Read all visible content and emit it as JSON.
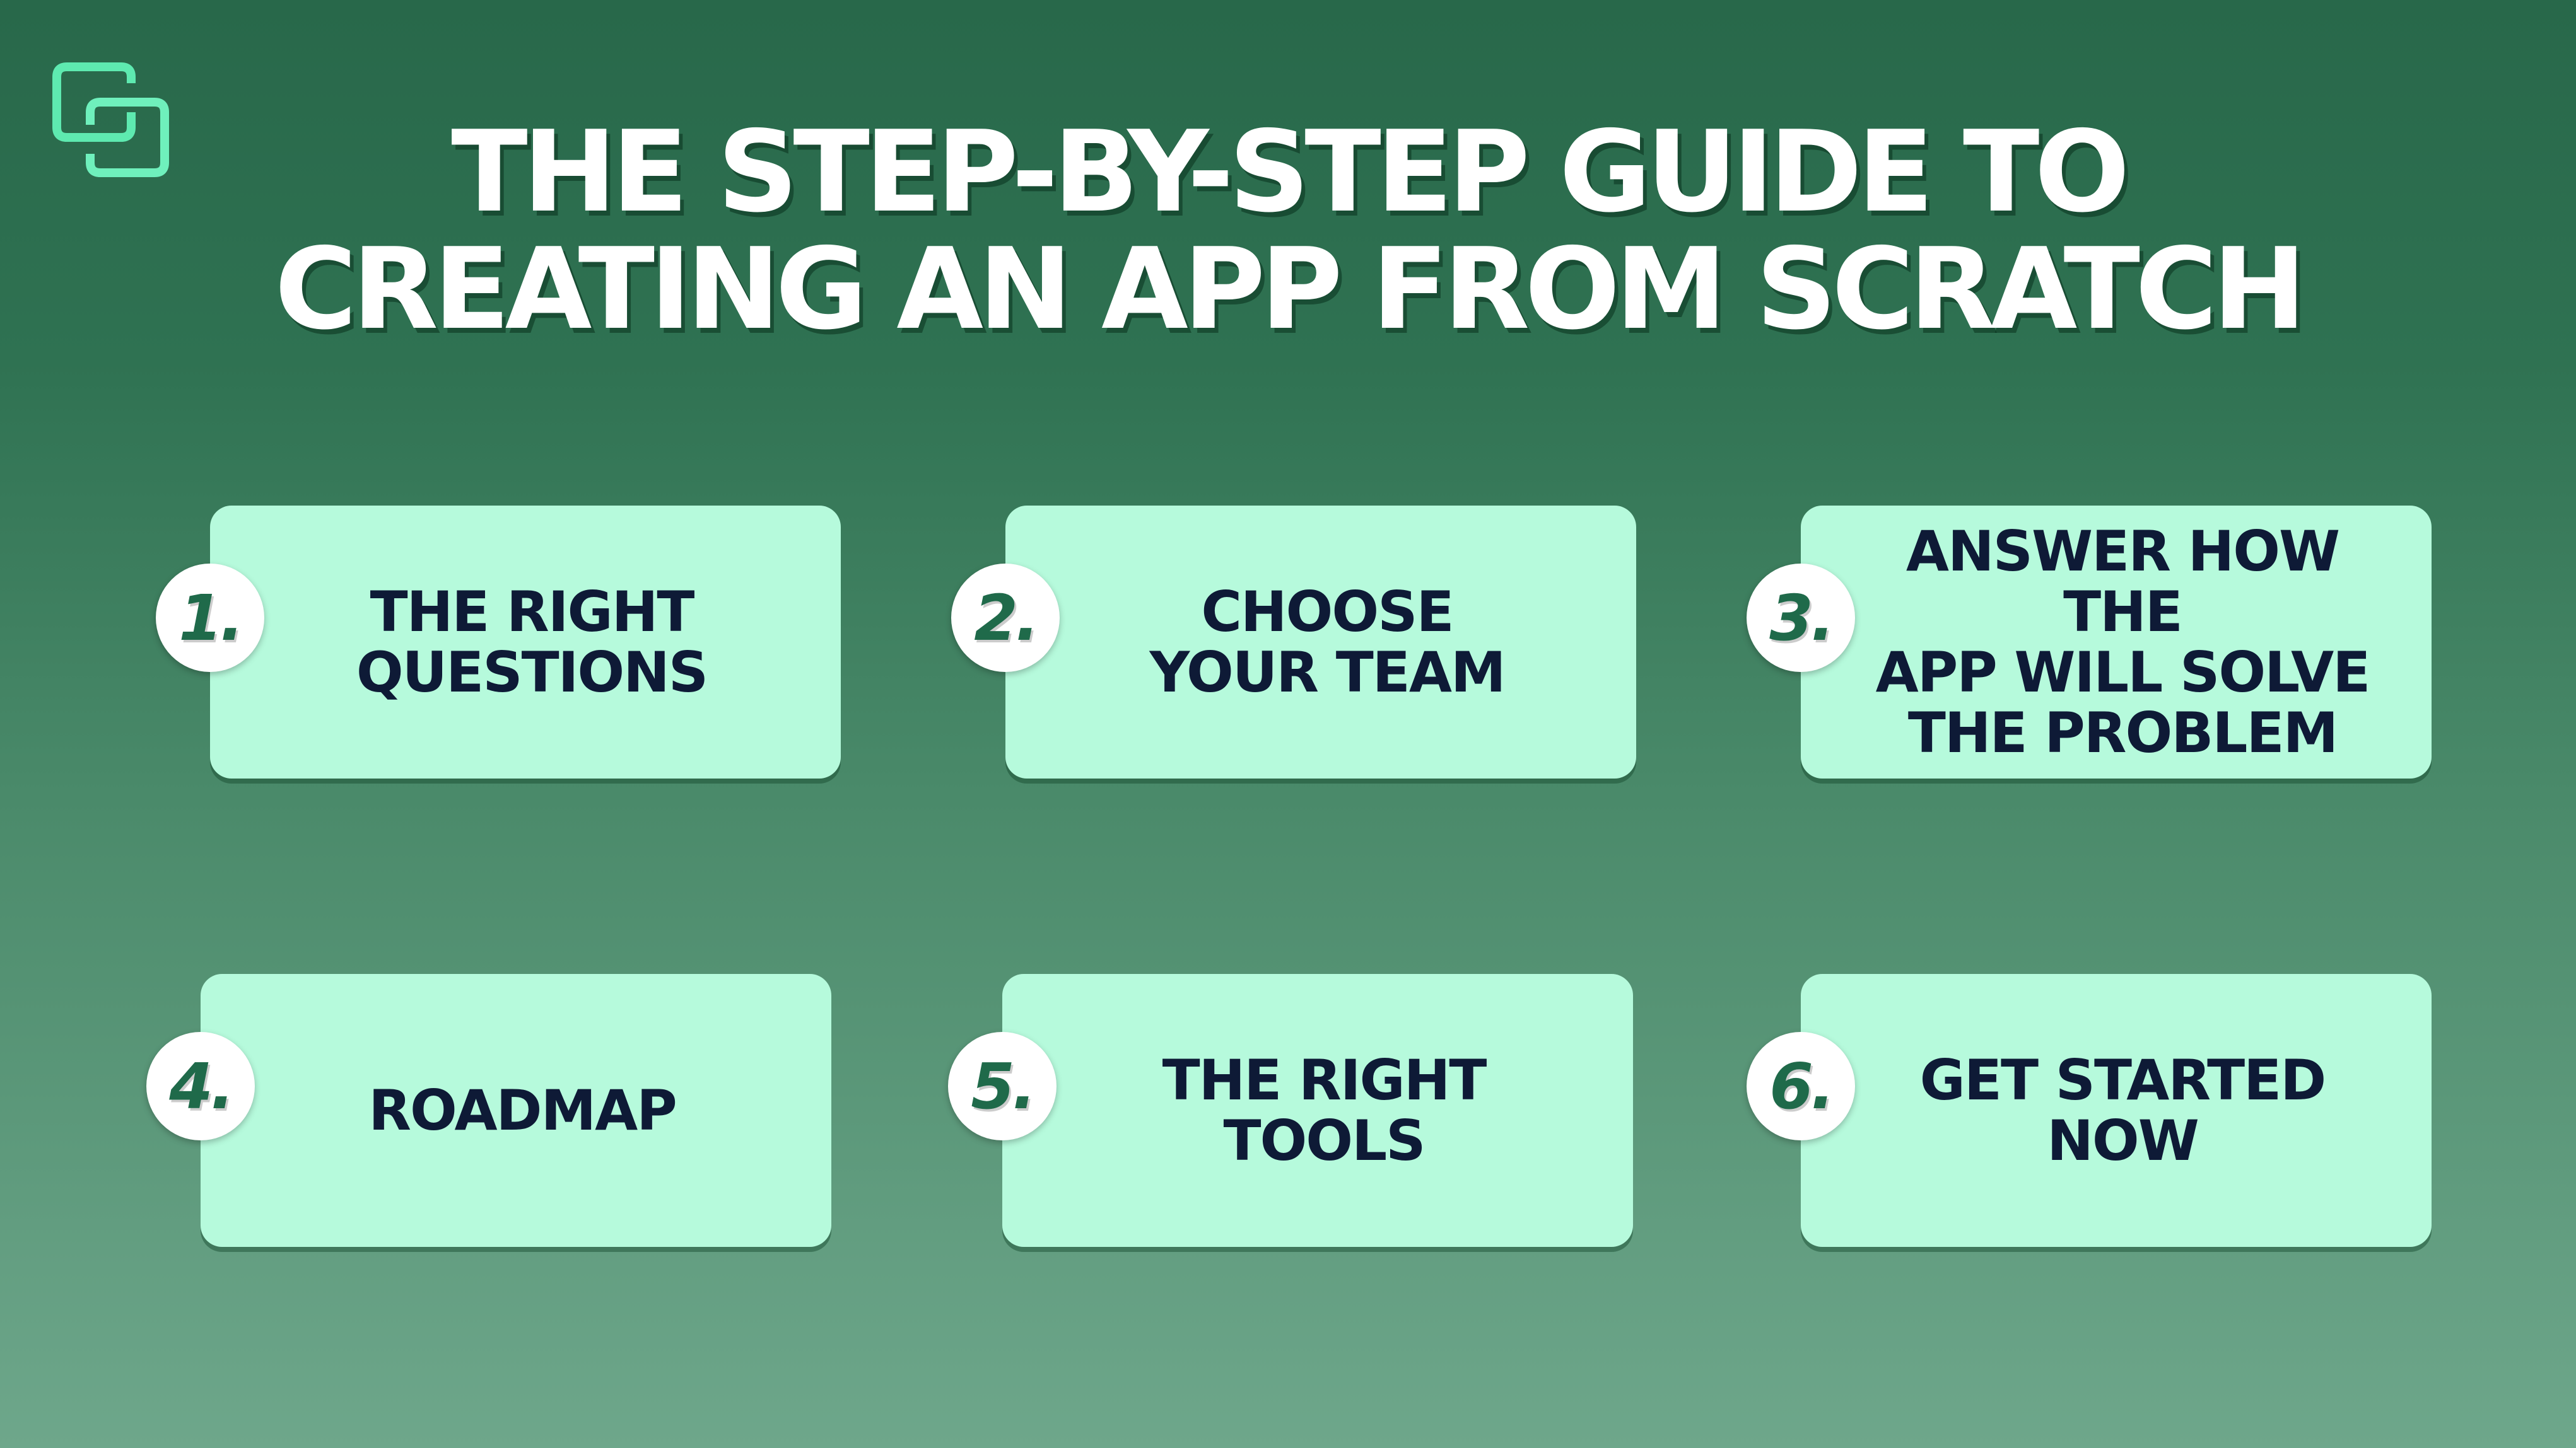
{
  "logo": {
    "icon": "interlocking-squares-logo",
    "color": "#5eeab0"
  },
  "title": {
    "line1": "THE STEP-BY-STEP GUIDE TO",
    "line2": "CREATING AN APP FROM SCRATCH"
  },
  "steps": [
    {
      "number": "1.",
      "label": "THE RIGHT\nQUESTIONS"
    },
    {
      "number": "2.",
      "label": "CHOOSE\nYOUR TEAM"
    },
    {
      "number": "3.",
      "label": "ANSWER HOW THE\nAPP WILL SOLVE\nTHE PROBLEM"
    },
    {
      "number": "4.",
      "label": "ROADMAP"
    },
    {
      "number": "5.",
      "label": "THE RIGHT\nTOOLS"
    },
    {
      "number": "6.",
      "label": "GET STARTED\nNOW"
    }
  ],
  "colors": {
    "card": "#b6fadc",
    "card_text": "#0e1a36",
    "badge_number": "#1f6a4a",
    "background_top": "#28684a",
    "background_bottom": "#6ea78b"
  }
}
